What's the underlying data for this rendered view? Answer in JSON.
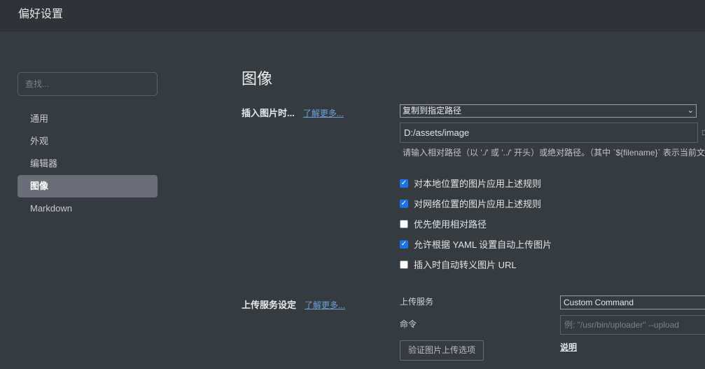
{
  "window": {
    "title": "偏好设置"
  },
  "search": {
    "placeholder": "查找..."
  },
  "sidebar": {
    "items": [
      {
        "label": "通用"
      },
      {
        "label": "外观"
      },
      {
        "label": "编辑器"
      },
      {
        "label": "图像",
        "active": true
      },
      {
        "label": "Markdown"
      }
    ]
  },
  "main": {
    "section_title": "图像",
    "insert": {
      "label": "插入图片时...",
      "learn_more": "了解更多...",
      "action_selected": "复制到指定路径",
      "path_value": "D:/assets/image",
      "hint": "请输入相对路径（以 './' 或 '../' 开头）或绝对路径。（其中 `${filename}` 表示当前文"
    },
    "checkboxes": [
      {
        "label": "对本地位置的图片应用上述规则",
        "checked": true
      },
      {
        "label": "对网络位置的图片应用上述规则",
        "checked": true
      },
      {
        "label": "优先使用相对路径",
        "checked": false
      },
      {
        "label": "允许根据 YAML 设置自动上传图片",
        "checked": true
      },
      {
        "label": "插入时自动转义图片 URL",
        "checked": false
      }
    ],
    "upload": {
      "label": "上传服务设定",
      "learn_more": "了解更多...",
      "service_label": "上传服务",
      "service_selected": "Custom Command",
      "command_label": "命令",
      "command_placeholder": "例: \"/usr/bin/uploader\" --upload",
      "explain_link": "说明",
      "verify_button": "验证图片上传选项"
    }
  },
  "colors": {
    "background": "#363b40",
    "titlebar": "#2f3338",
    "sidebar_active": "#6b6e76",
    "link": "#6ea0d8",
    "checkbox_checked": "#1a73e8"
  }
}
